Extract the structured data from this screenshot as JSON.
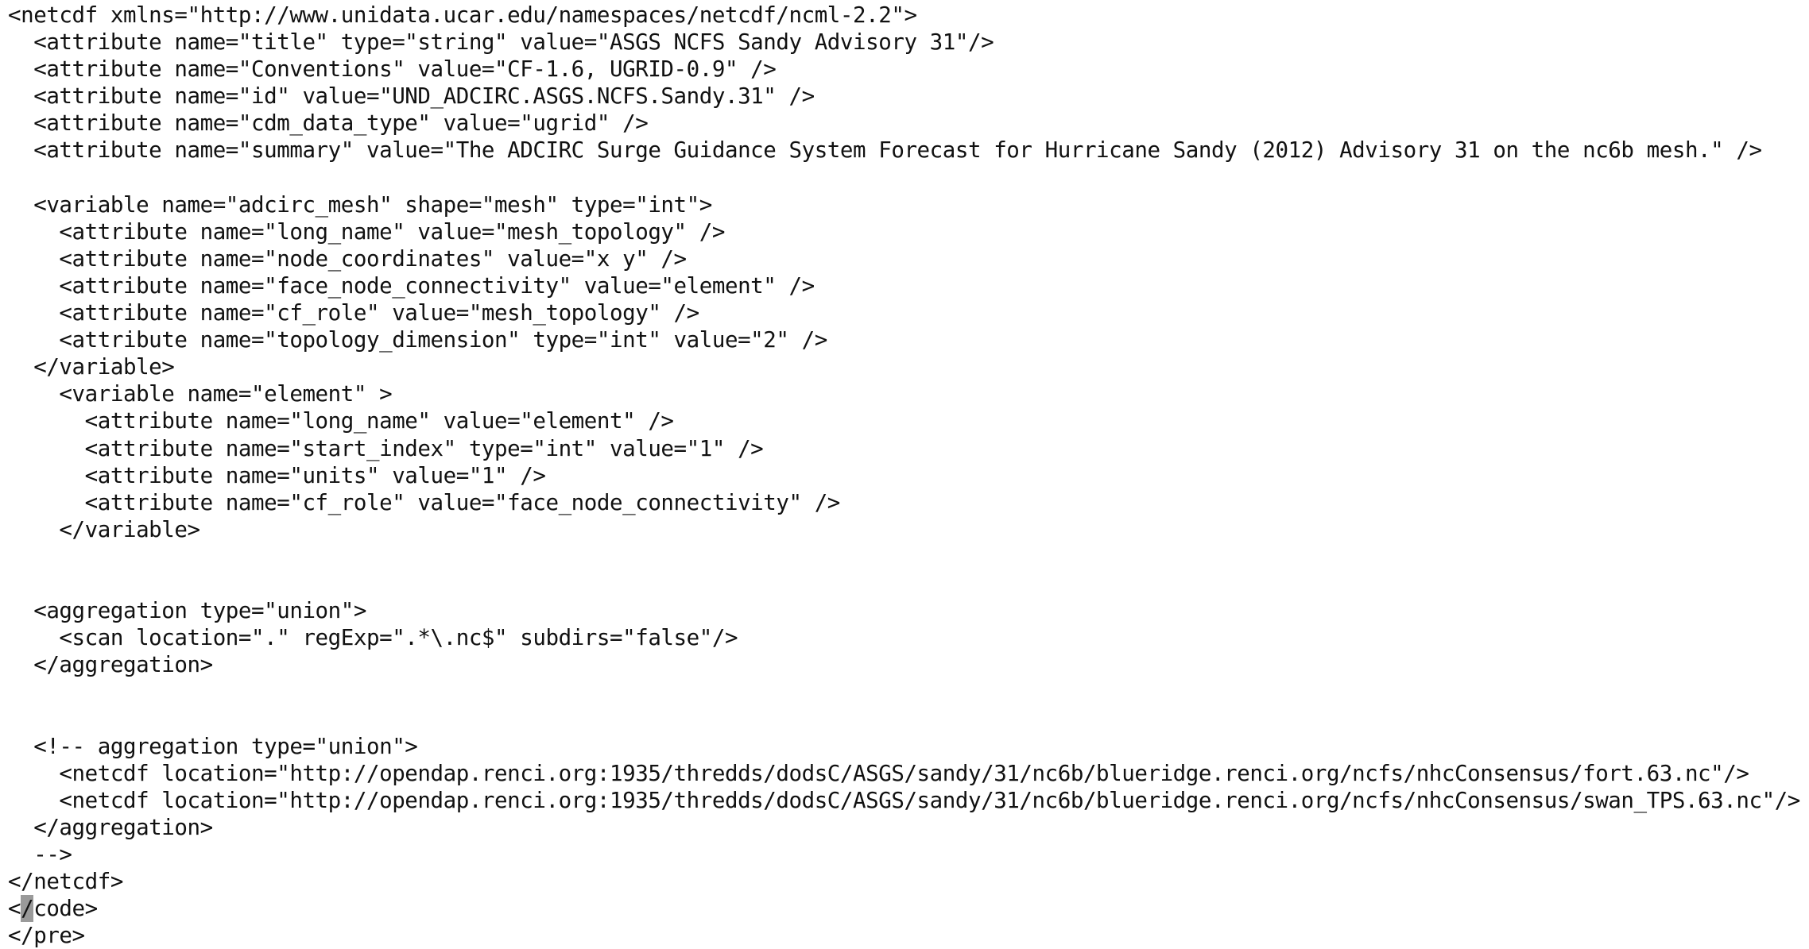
{
  "editor": {
    "lines": [
      "<netcdf xmlns=\"http://www.unidata.ucar.edu/namespaces/netcdf/ncml-2.2\">",
      "  <attribute name=\"title\" type=\"string\" value=\"ASGS NCFS Sandy Advisory 31\"/>",
      "  <attribute name=\"Conventions\" value=\"CF-1.6, UGRID-0.9\" />",
      "  <attribute name=\"id\" value=\"UND_ADCIRC.ASGS.NCFS.Sandy.31\" />",
      "  <attribute name=\"cdm_data_type\" value=\"ugrid\" />",
      "  <attribute name=\"summary\" value=\"The ADCIRC Surge Guidance System Forecast for Hurricane Sandy (2012) Advisory 31 on the nc6b mesh.\" />",
      "",
      "  <variable name=\"adcirc_mesh\" shape=\"mesh\" type=\"int\">",
      "    <attribute name=\"long_name\" value=\"mesh_topology\" />",
      "    <attribute name=\"node_coordinates\" value=\"x y\" />",
      "    <attribute name=\"face_node_connectivity\" value=\"element\" />",
      "    <attribute name=\"cf_role\" value=\"mesh_topology\" />",
      "    <attribute name=\"topology_dimension\" type=\"int\" value=\"2\" />",
      "  </variable>",
      "    <variable name=\"element\" >",
      "      <attribute name=\"long_name\" value=\"element\" />",
      "      <attribute name=\"start_index\" type=\"int\" value=\"1\" />",
      "      <attribute name=\"units\" value=\"1\" />",
      "      <attribute name=\"cf_role\" value=\"face_node_connectivity\" />",
      "    </variable>",
      "",
      "",
      "  <aggregation type=\"union\">",
      "    <scan location=\".\" regExp=\".*\\.nc$\" subdirs=\"false\"/>",
      "  </aggregation>",
      "",
      "",
      "  <!-- aggregation type=\"union\">",
      "    <netcdf location=\"http://opendap.renci.org:1935/thredds/dodsC/ASGS/sandy/31/nc6b/blueridge.renci.org/ncfs/nhcConsensus/fort.63.nc\"/>",
      "    <netcdf location=\"http://opendap.renci.org:1935/thredds/dodsC/ASGS/sandy/31/nc6b/blueridge.renci.org/ncfs/nhcConsensus/swan_TPS.63.nc\"/>",
      "  </aggregation>",
      "  -->",
      "</netcdf>",
      "</code>",
      "</pre>"
    ],
    "cursor_line": {
      "before": "<",
      "selected": "/",
      "after": "code>"
    }
  }
}
